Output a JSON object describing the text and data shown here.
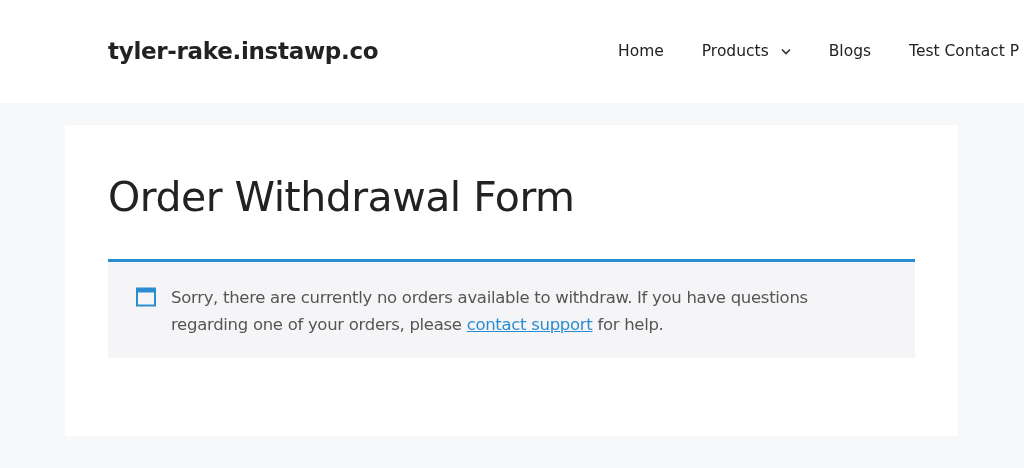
{
  "site_title": "tyler-rake.instawp.co",
  "nav": [
    {
      "label": "Home",
      "dropdown": false
    },
    {
      "label": "Products",
      "dropdown": true
    },
    {
      "label": "Blogs",
      "dropdown": false
    },
    {
      "label": "Test Contact P",
      "dropdown": false
    }
  ],
  "page_title": "Order Withdrawal Form",
  "notice": {
    "text_before": "Sorry, there are currently no orders available to withdraw. If you have questions regarding one of your orders, please ",
    "link": "contact support",
    "text_after": " for help."
  }
}
